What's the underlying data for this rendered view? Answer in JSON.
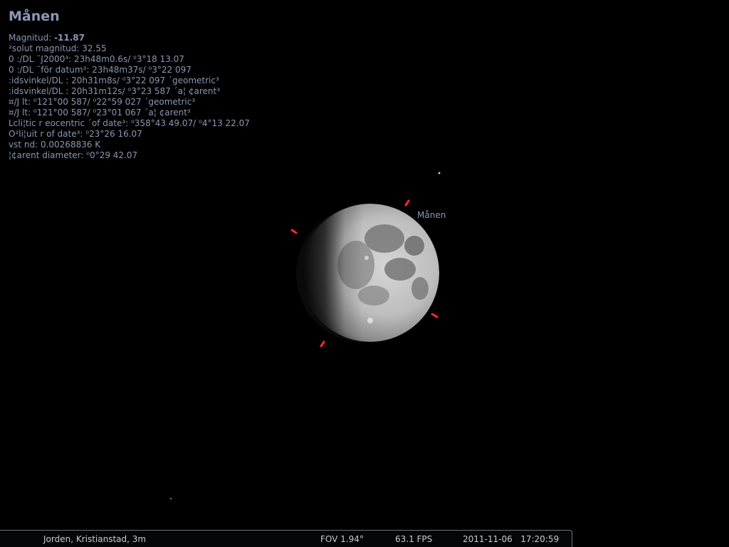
{
  "object": {
    "name": "Månen",
    "label": "Månen"
  },
  "info": {
    "magnitude_label": "Magnitud: ",
    "magnitude_value": "-11.87",
    "lines": [
      "  ²solut magnitud: 32.55",
      "0 :/DL ¨J2000³: 23h48m0.6s/ ⁰3°18 13.07",
      "0 :/DL ¨för datum³: 23h48m37s/ ⁰3°22 097",
      ":idsvinkel/DL : 20h31m8s/ ⁰3°22 097 ´geometric³",
      ":idsvinkel/DL : 20h31m12s/ ⁰3°23 587 ´a¦ ¢arent³",
      "  ¤/J  lt:  ⁰121°00 587/ ⁰22°59 027 ´geometric³",
      "  ¤/J  lt:  ⁰121°00 587/ ⁰23°01 067 ´a¦ ¢arent³",
      "Lcli¦tic  r eocentric ´of date³:  ⁰358°43 49.07/ ⁰4°13 22.07",
      "O²li¦uit  r of date³:  ⁰23°26 16.07",
      "  vst  nd: 0.00268836   K",
      "  ¦¢arent diameter:  ⁰0°29 42.07"
    ]
  },
  "statusbar": {
    "location": "Jorden, Kristianstad, 3m",
    "fov": "FOV 1.94°",
    "fps": "63.1 FPS",
    "date": "2011-11-06",
    "time": "17:20:59"
  },
  "colors": {
    "background": "#000000",
    "info_text": "#8a96b4",
    "marker": "#ff2a2a",
    "statusbar_text": "#c8ccd2"
  }
}
